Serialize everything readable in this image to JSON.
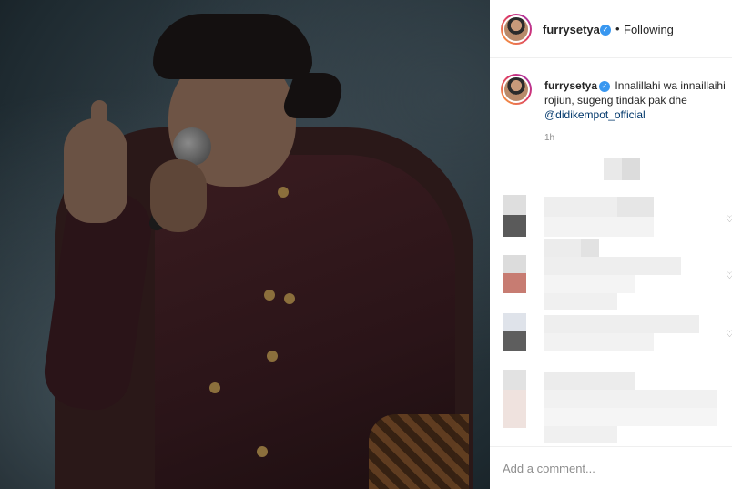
{
  "post": {
    "username": "furrysetya",
    "verified_mark": "✓",
    "separator": "•",
    "follow_status": "Following"
  },
  "caption": {
    "username": "furrysetya",
    "text": " Innalillahi wa innaillaihi rojiun, sugeng tindak pak dhe ",
    "mention": "@didikempot_official",
    "time": "1h"
  },
  "comment_box": {
    "placeholder": "Add a comment..."
  },
  "colors": {
    "verified": "#3897f0",
    "mention": "#00376b",
    "muted": "#8e8e8e"
  },
  "icons": [
    "verified-badge-icon",
    "heart-icon"
  ]
}
